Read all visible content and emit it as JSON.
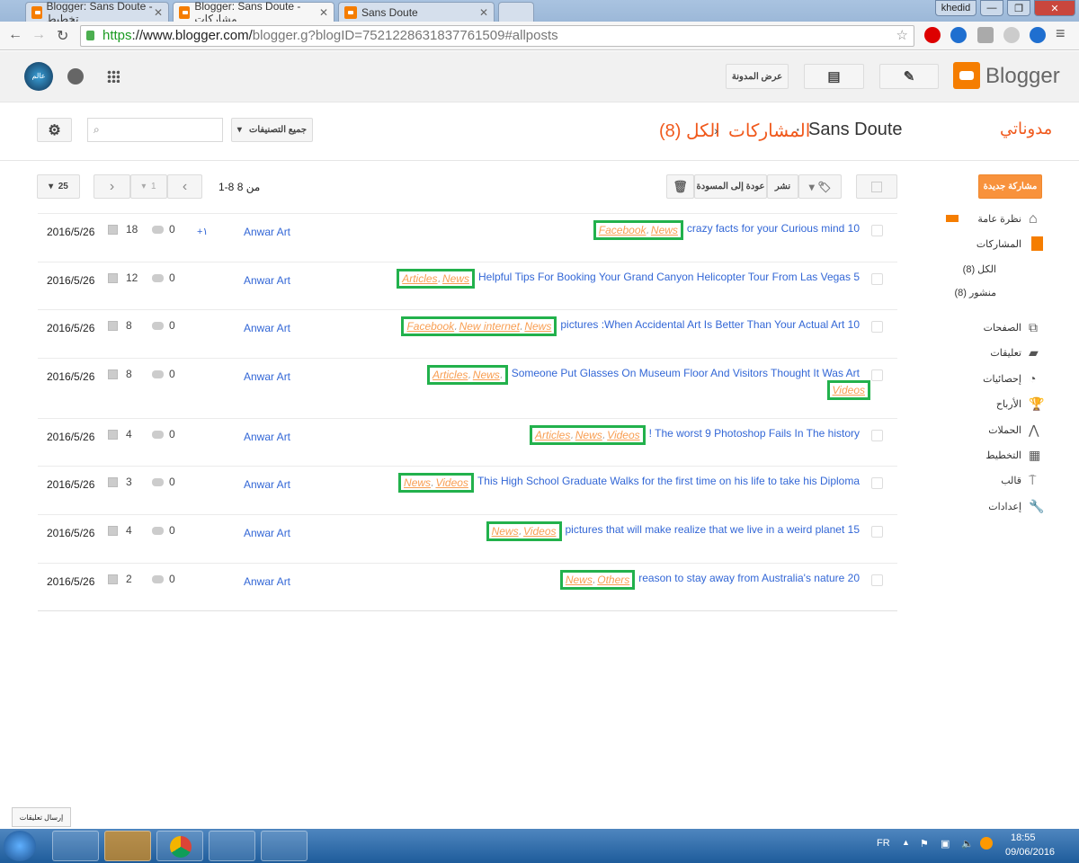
{
  "browser": {
    "tabs": [
      {
        "title": "Blogger: Sans Doute - تخطيط"
      },
      {
        "title": "Blogger: Sans Doute - مشاركات"
      },
      {
        "title": "Sans Doute"
      }
    ],
    "user": "khedid",
    "url_scheme": "https",
    "url_host": "://www.blogger.com/",
    "url_path": "blogger.g?blogID=7521228631837761509#allposts"
  },
  "header": {
    "brand": "Blogger",
    "view_blog": "عرض المدونة",
    "avatar_text": "عالم"
  },
  "breadcrumb": {
    "my_blogs": "مدوناتي",
    "blog": "Sans Doute",
    "posts": "المشاركات",
    "all": "الكل (8)",
    "dot": "·",
    "sep": "›"
  },
  "filter": {
    "categories": "جميع التصنيفات"
  },
  "toolbar": {
    "new_post": "مشاركة جديدة",
    "publish": "نشر",
    "revert": "عودة إلى المسودة",
    "range": "1-8 من 8",
    "page": "1",
    "per_page": "25"
  },
  "sidebar": {
    "overview": "نظرة عامة",
    "posts": "المشاركات",
    "all": "الكل (8)",
    "published": "منشور (8)",
    "items": [
      "الصفحات",
      "تعليقات",
      "إحصائيات",
      "الأرباح",
      "الحملات",
      "التخطيط",
      "قالب",
      "إعدادات"
    ]
  },
  "posts": [
    {
      "date": "2016/5/26",
      "images": "18",
      "comments": "0",
      "gplus": "+۱",
      "author": "Anwar Art",
      "title": "crazy facts for your Curious mind 10",
      "labels": [
        "Facebook",
        "News"
      ]
    },
    {
      "date": "2016/5/26",
      "images": "12",
      "comments": "0",
      "author": "Anwar Art",
      "title": "Helpful Tips For Booking Your Grand Canyon Helicopter Tour From Las Vegas 5",
      "labels": [
        "Articles",
        "News"
      ]
    },
    {
      "date": "2016/5/26",
      "images": "8",
      "comments": "0",
      "author": "Anwar Art",
      "title": "pictures :When Accidental Art Is Better Than Your Actual Art 10",
      "labels": [
        "Facebook",
        "New internet",
        "News"
      ]
    },
    {
      "date": "2016/5/26",
      "images": "8",
      "comments": "0",
      "author": "Anwar Art",
      "title": "Someone Put Glasses On Museum Floor And Visitors Thought It Was Art",
      "labels": [
        "Articles",
        "News"
      ],
      "wrap_labels": [
        "Videos"
      ]
    },
    {
      "date": "2016/5/26",
      "images": "4",
      "comments": "0",
      "author": "Anwar Art",
      "title": "! The worst 9 Photoshop Fails In The history",
      "labels": [
        "Articles",
        "News",
        "Videos"
      ]
    },
    {
      "date": "2016/5/26",
      "images": "3",
      "comments": "0",
      "author": "Anwar Art",
      "title": "This High School Graduate Walks for the first time on his life to take his Diploma",
      "labels": [
        "News",
        "Videos"
      ]
    },
    {
      "date": "2016/5/26",
      "images": "4",
      "comments": "0",
      "author": "Anwar Art",
      "title": "pictures that will make realize that we live in a weird planet 15",
      "labels": [
        "News",
        "Videos"
      ]
    },
    {
      "date": "2016/5/26",
      "images": "2",
      "comments": "0",
      "author": "Anwar Art",
      "title": "reason to stay away from Australia's nature 20",
      "labels": [
        "News",
        "Others"
      ]
    }
  ],
  "feedback": "إرسال تعليقات",
  "taskbar": {
    "lang": "FR",
    "time": "18:55",
    "date": "09/06/2016"
  },
  "colors": {
    "accent": "#f57d00",
    "link": "#3367d6",
    "highlight": "#22b14c"
  }
}
